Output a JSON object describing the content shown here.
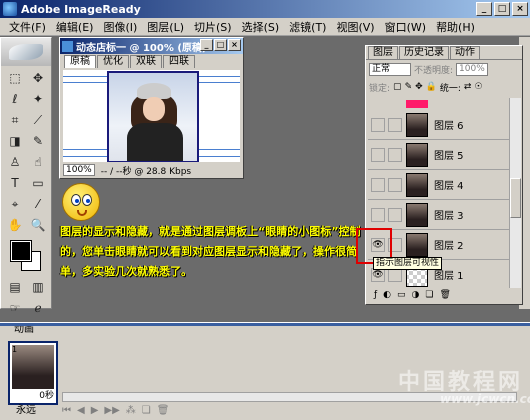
{
  "app": {
    "title": "Adobe ImageReady"
  },
  "menu": [
    "文件(F)",
    "编辑(E)",
    "图像(I)",
    "图层(L)",
    "切片(S)",
    "选择(S)",
    "滤镜(T)",
    "视图(V)",
    "窗口(W)",
    "帮助(H)"
  ],
  "document": {
    "title": "动态店标一 @ 100% (原稿)",
    "tabs": [
      "原稿",
      "优化",
      "双联",
      "四联"
    ],
    "zoom": "100%",
    "status_size": "-- / --秒 @ 28.8 Kbps"
  },
  "tutorial_text": "图层的显示和隐藏，就是通过图层调板上“眼睛的小图标”控制的，您单击眼睛就可以看到对应图层显示和隐藏了，操作很简单，多实验几次就熟悉了。",
  "layers_panel": {
    "tabs": [
      "图层",
      "历史记录",
      "动作"
    ],
    "blend_mode": "正常",
    "opacity_label": "不透明度:",
    "opacity_value": "100%",
    "lock_label": "锁定:",
    "unify_label": "统一:",
    "layers": [
      {
        "name": "图层 6",
        "visible": false
      },
      {
        "name": "图层 5",
        "visible": false
      },
      {
        "name": "图层 4",
        "visible": false
      },
      {
        "name": "图层 3",
        "visible": false
      },
      {
        "name": "图层 2",
        "visible": true
      },
      {
        "name": "图层 1",
        "visible": true
      }
    ],
    "tooltip": "指示图层可视性"
  },
  "animation": {
    "tab": "动画",
    "frame_number": "1",
    "frame_time": "0秒",
    "loop": "永远"
  },
  "watermark": {
    "text": "中国教程网",
    "url": "www.jcwcn.com"
  },
  "colors": {
    "title_bar": "#0a246a",
    "chrome": "#d4d0c8",
    "workspace": "#6b6b6b",
    "tutorial_text": "#ffff00",
    "highlight": "#e00000"
  }
}
